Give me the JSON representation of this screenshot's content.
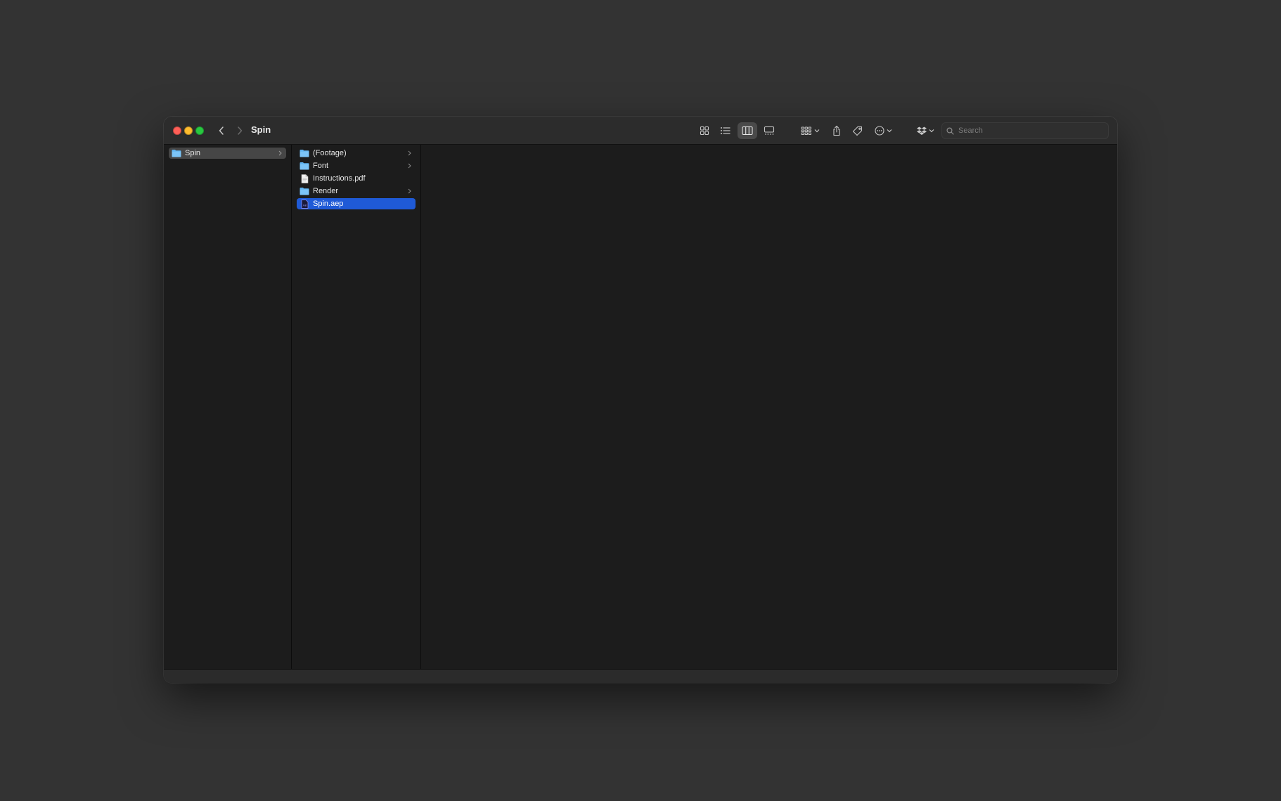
{
  "window": {
    "title": "Spin"
  },
  "toolbar": {
    "views": [
      {
        "name": "icon-view-icon",
        "active": false
      },
      {
        "name": "list-view-icon",
        "active": false
      },
      {
        "name": "column-view-icon",
        "active": true
      },
      {
        "name": "gallery-view-icon",
        "active": false
      }
    ],
    "search_placeholder": "Search"
  },
  "columns": [
    {
      "items": [
        {
          "label": "Spin",
          "type": "folder",
          "has_children": true,
          "state": "selected-inactive"
        }
      ]
    },
    {
      "items": [
        {
          "label": "(Footage)",
          "type": "folder",
          "has_children": true,
          "state": "normal"
        },
        {
          "label": "Font",
          "type": "folder",
          "has_children": true,
          "state": "normal"
        },
        {
          "label": "Instructions.pdf",
          "type": "document",
          "has_children": false,
          "state": "normal"
        },
        {
          "label": "Render",
          "type": "folder",
          "has_children": true,
          "state": "normal"
        },
        {
          "label": "Spin.aep",
          "type": "after-effects-file",
          "has_children": false,
          "state": "selected"
        }
      ]
    }
  ],
  "colors": {
    "selection": "#1f5ad6",
    "folder": "#5fb3f0",
    "after_effects": "#9999ff"
  }
}
